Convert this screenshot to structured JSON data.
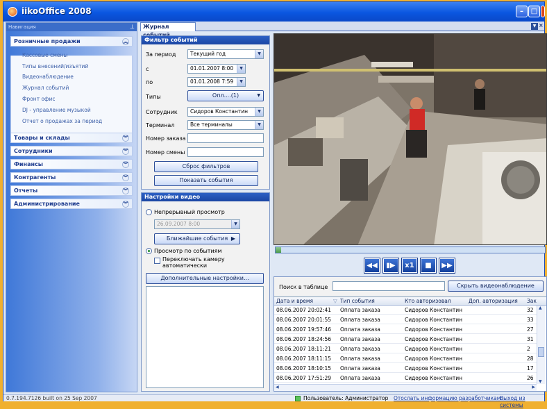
{
  "app": {
    "title": "iikoOffice 2008"
  },
  "nav": {
    "header": "Навигация",
    "pin": "0",
    "groups": [
      {
        "label": "Розничные продажи",
        "expanded": true,
        "items": [
          "Кассовые смены",
          "Типы внесений/изъятий",
          "Видеонаблюдение",
          "Журнал событий",
          "Фронт офис",
          "DJ - управление музыкой",
          "Отчет о продажах за период"
        ]
      },
      {
        "label": "Товары и склады"
      },
      {
        "label": "Сотрудники"
      },
      {
        "label": "Финансы"
      },
      {
        "label": "Контрагенты"
      },
      {
        "label": "Отчеты"
      },
      {
        "label": "Администрирование"
      }
    ]
  },
  "tab": {
    "label": "Журнал событий"
  },
  "filter": {
    "title": "Фильтр событий",
    "period_label": "За период",
    "period_value": "Текущий год",
    "from_label": "с",
    "from_value": "01.01.2007 8:00",
    "to_label": "по",
    "to_value": "01.01.2008 7:59",
    "types_label": "Типы",
    "types_value": "Опл....(1)",
    "employee_label": "Сотрудник",
    "employee_value": "Сидоров Константин",
    "terminal_label": "Терминал",
    "terminal_value": "Все терминалы",
    "order_label": "Номер заказа",
    "shift_label": "Номер смены",
    "reset_button": "Сброс фильтров",
    "show_button": "Показать события"
  },
  "video_settings": {
    "title": "Настройки видео",
    "continuous_label": "Непрерывный просмотр",
    "continuous_date": "26.09.2007 8:00",
    "nearest_button": "Ближайшие события",
    "by_events_label": "Просмотр по событиям",
    "switch_camera_label": "Переключать камеру автоматически",
    "advanced_button": "Дополнительные настройки..."
  },
  "player": {
    "speed_label": "x1",
    "progress": 0.02
  },
  "table": {
    "search_label": "Поиск в таблице",
    "hide_video_button": "Скрыть видеонаблюдение",
    "columns": [
      "Дата и время",
      "Тип события",
      "Кто авторизовал",
      "Доп. авторизация",
      "Зак"
    ],
    "rows": [
      [
        "08.06.2007 20:02:41",
        "Оплата заказа",
        "Сидоров Константин",
        "",
        "32"
      ],
      [
        "08.06.2007 20:01:55",
        "Оплата заказа",
        "Сидоров Константин",
        "",
        "33"
      ],
      [
        "08.06.2007 19:57:46",
        "Оплата заказа",
        "Сидоров Константин",
        "",
        "27"
      ],
      [
        "08.06.2007 18:24:56",
        "Оплата заказа",
        "Сидоров Константин",
        "",
        "31"
      ],
      [
        "08.06.2007 18:11:21",
        "Оплата заказа",
        "Сидоров Константин",
        "",
        "2"
      ],
      [
        "08.06.2007 18:11:15",
        "Оплата заказа",
        "Сидоров Константин",
        "",
        "28"
      ],
      [
        "08.06.2007 18:10:15",
        "Оплата заказа",
        "Сидоров Константин",
        "",
        "17"
      ],
      [
        "08.06.2007 17:51:29",
        "Оплата заказа",
        "Сидоров Константин",
        "",
        "26"
      ]
    ]
  },
  "status": {
    "build": "0.7.194.7126 built on 25 Sep 2007",
    "user": "Пользователь: Администратор",
    "send_info_link": "Отослать информацию разработчикам",
    "logout_link": "Выход из системы"
  },
  "colors": {
    "accent": "#2c5fc4",
    "titlebar": "#0a56e0",
    "desktop": "#f0b030"
  }
}
